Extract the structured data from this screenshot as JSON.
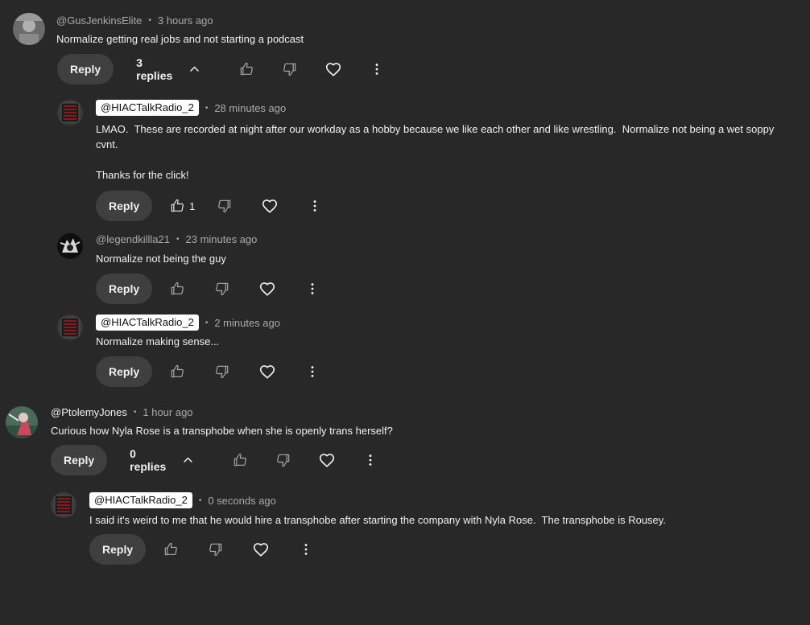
{
  "comments": [
    {
      "author": "@GusJenkinsElite",
      "time": "3 hours ago",
      "text": "Normalize getting real jobs and not starting a podcast",
      "reply_label": "Reply",
      "replies_label": "3 replies"
    },
    {
      "author": "@HIACTalkRadio_2",
      "time": "28 minutes ago",
      "text": "LMAO.  These are recorded at night after our workday as a hobby because we like each other and like wrestling.  Normalize not being a wet soppy cvnt.\n\nThanks for the click!",
      "reply_label": "Reply",
      "likes": "1"
    },
    {
      "author": "@legendkillla21",
      "time": "23 minutes ago",
      "text": "Normalize not being the guy",
      "reply_label": "Reply"
    },
    {
      "author": "@HIACTalkRadio_2",
      "time": "2 minutes ago",
      "text": "Normalize making sense...",
      "reply_label": "Reply"
    },
    {
      "author": "@PtolemyJones",
      "time": "1 hour ago",
      "text": "Curious how Nyla Rose is a transphobe when she is openly trans herself?",
      "reply_label": "Reply",
      "replies_label": "0 replies"
    },
    {
      "author": "@HIACTalkRadio_2",
      "time": "0 seconds ago",
      "text": "I said it's weird to me that he would hire a transphobe after starting the company with Nyla Rose.  The transphobe is Rousey.",
      "reply_label": "Reply"
    }
  ],
  "icons": {
    "like": "thumbs-up-icon",
    "dislike": "thumbs-down-icon",
    "heart": "heart-icon",
    "more": "more-vert-icon",
    "chevron": "chevron-up-icon"
  },
  "colors": {
    "background": "#282828",
    "text": "#f1f1f1",
    "secondary": "#aaaaaa",
    "button": "#3f3f3f",
    "owner_badge_bg": "#ffffff"
  }
}
